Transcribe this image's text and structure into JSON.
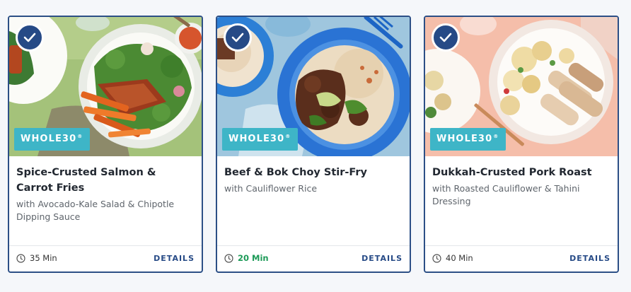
{
  "recipes": [
    {
      "title": "Spice-Crusted Salmon & Carrot Fries",
      "subtitle": "with Avocado-Kale Salad & Chipotle Dipping Sauce",
      "badge": "WHOLE30",
      "badge_mark": "®",
      "time": "35 Min",
      "details": "DETAILS",
      "selected": true,
      "icon": "check-icon"
    },
    {
      "title": "Beef & Bok Choy Stir-Fry",
      "subtitle": "with Cauliflower Rice",
      "badge": "WHOLE30",
      "badge_mark": "®",
      "time": "20 Min",
      "details": "DETAILS",
      "selected": true,
      "icon": "check-icon"
    },
    {
      "title": "Dukkah-Crusted Pork Roast",
      "subtitle": "with Roasted Cauliflower & Tahini Dressing",
      "badge": "WHOLE30",
      "badge_mark": "®",
      "time": "40 Min",
      "details": "DETAILS",
      "selected": true,
      "icon": "check-icon"
    }
  ],
  "colors": {
    "border": "#2c4f86",
    "check_bg": "#264a86",
    "badge_bg": "#3eb5c7",
    "fast_time": "#1c9a57",
    "details": "#264a86"
  }
}
